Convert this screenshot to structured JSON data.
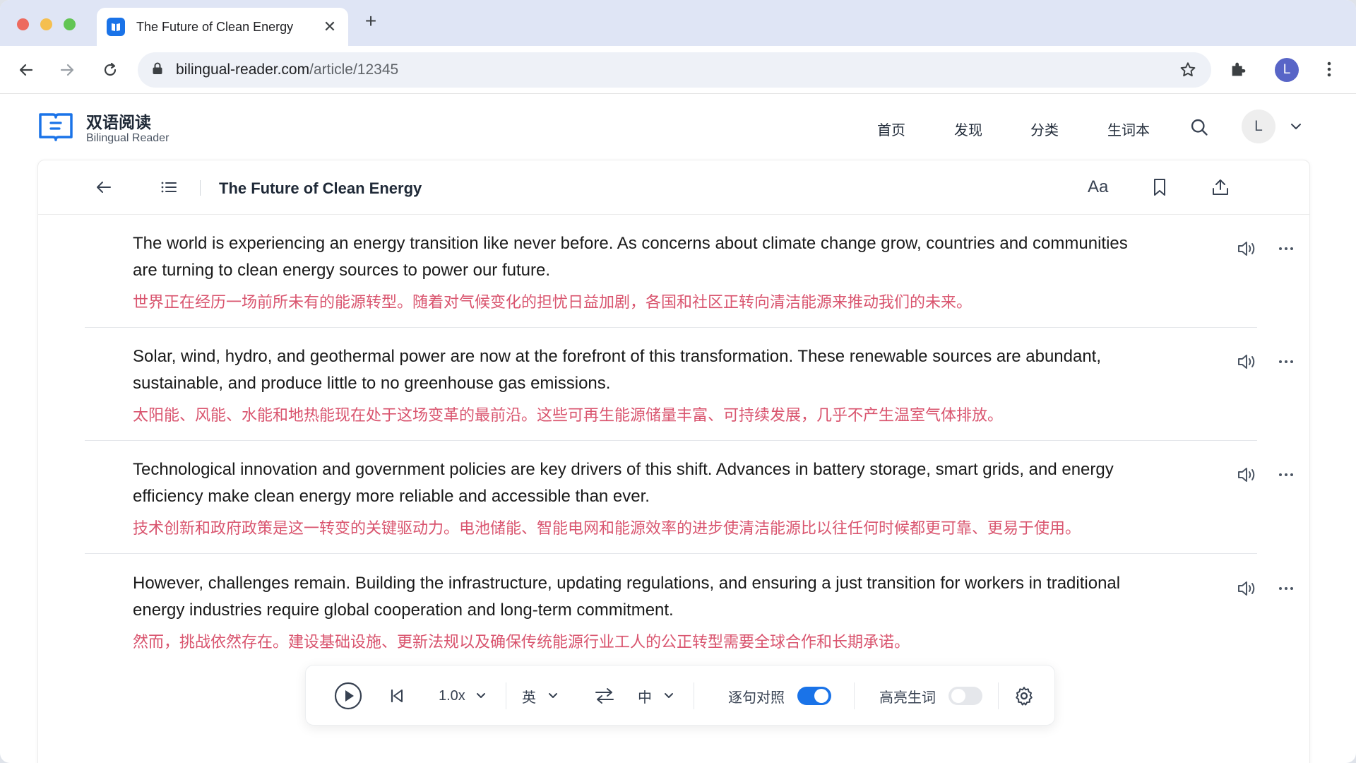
{
  "browser": {
    "tab_title": "The Future of Clean Energy",
    "tab_close": "✕",
    "new_tab": "+",
    "url_domain": "bilingual-reader.com",
    "url_path": "/article/12345",
    "profile_initial": "L"
  },
  "app": {
    "brand_title": "双语阅读",
    "brand_subtitle": "Bilingual Reader",
    "nav": [
      "首页",
      "发现",
      "分类",
      "生词本"
    ],
    "avatar_initial": "L"
  },
  "reader": {
    "title": "The Future of Clean Energy",
    "font_button": "Aa",
    "sentences": [
      {
        "en": "The world is experiencing an energy transition like never before. As concerns about climate change grow, countries and communities are turning to clean energy sources to power our future.",
        "zh": "世界正在经历一场前所未有的能源转型。随着对气候变化的担忧日益加剧，各国和社区正转向清洁能源来推动我们的未来。"
      },
      {
        "en": "Solar, wind, hydro, and geothermal power are now at the forefront of this transformation. These renewable sources are abundant, sustainable, and produce little to no greenhouse gas emissions.",
        "zh": "太阳能、风能、水能和地热能现在处于这场变革的最前沿。这些可再生能源储量丰富、可持续发展，几乎不产生温室气体排放。"
      },
      {
        "en": "Technological innovation and government policies are key drivers of this shift. Advances in battery storage, smart grids, and energy efficiency make clean energy more reliable and accessible than ever.",
        "zh": "技术创新和政府政策是这一转变的关键驱动力。电池储能、智能电网和能源效率的进步使清洁能源比以往任何时候都更可靠、更易于使用。"
      },
      {
        "en": "However, challenges remain. Building the infrastructure, updating regulations, and ensuring a just transition for workers in traditional energy industries require global cooperation and long-term commitment.",
        "zh": "然而，挑战依然存在。建设基础设施、更新法规以及确保传统能源行业工人的公正转型需要全球合作和长期承诺。"
      }
    ]
  },
  "player": {
    "speed": "1.0x",
    "source_lang": "英",
    "target_lang": "中",
    "sentence_align_label": "逐句对照",
    "sentence_align_on": true,
    "highlight_label": "高亮生词",
    "highlight_on": false
  },
  "colors": {
    "accent": "#1a73e8",
    "translation": "#d9546e"
  }
}
